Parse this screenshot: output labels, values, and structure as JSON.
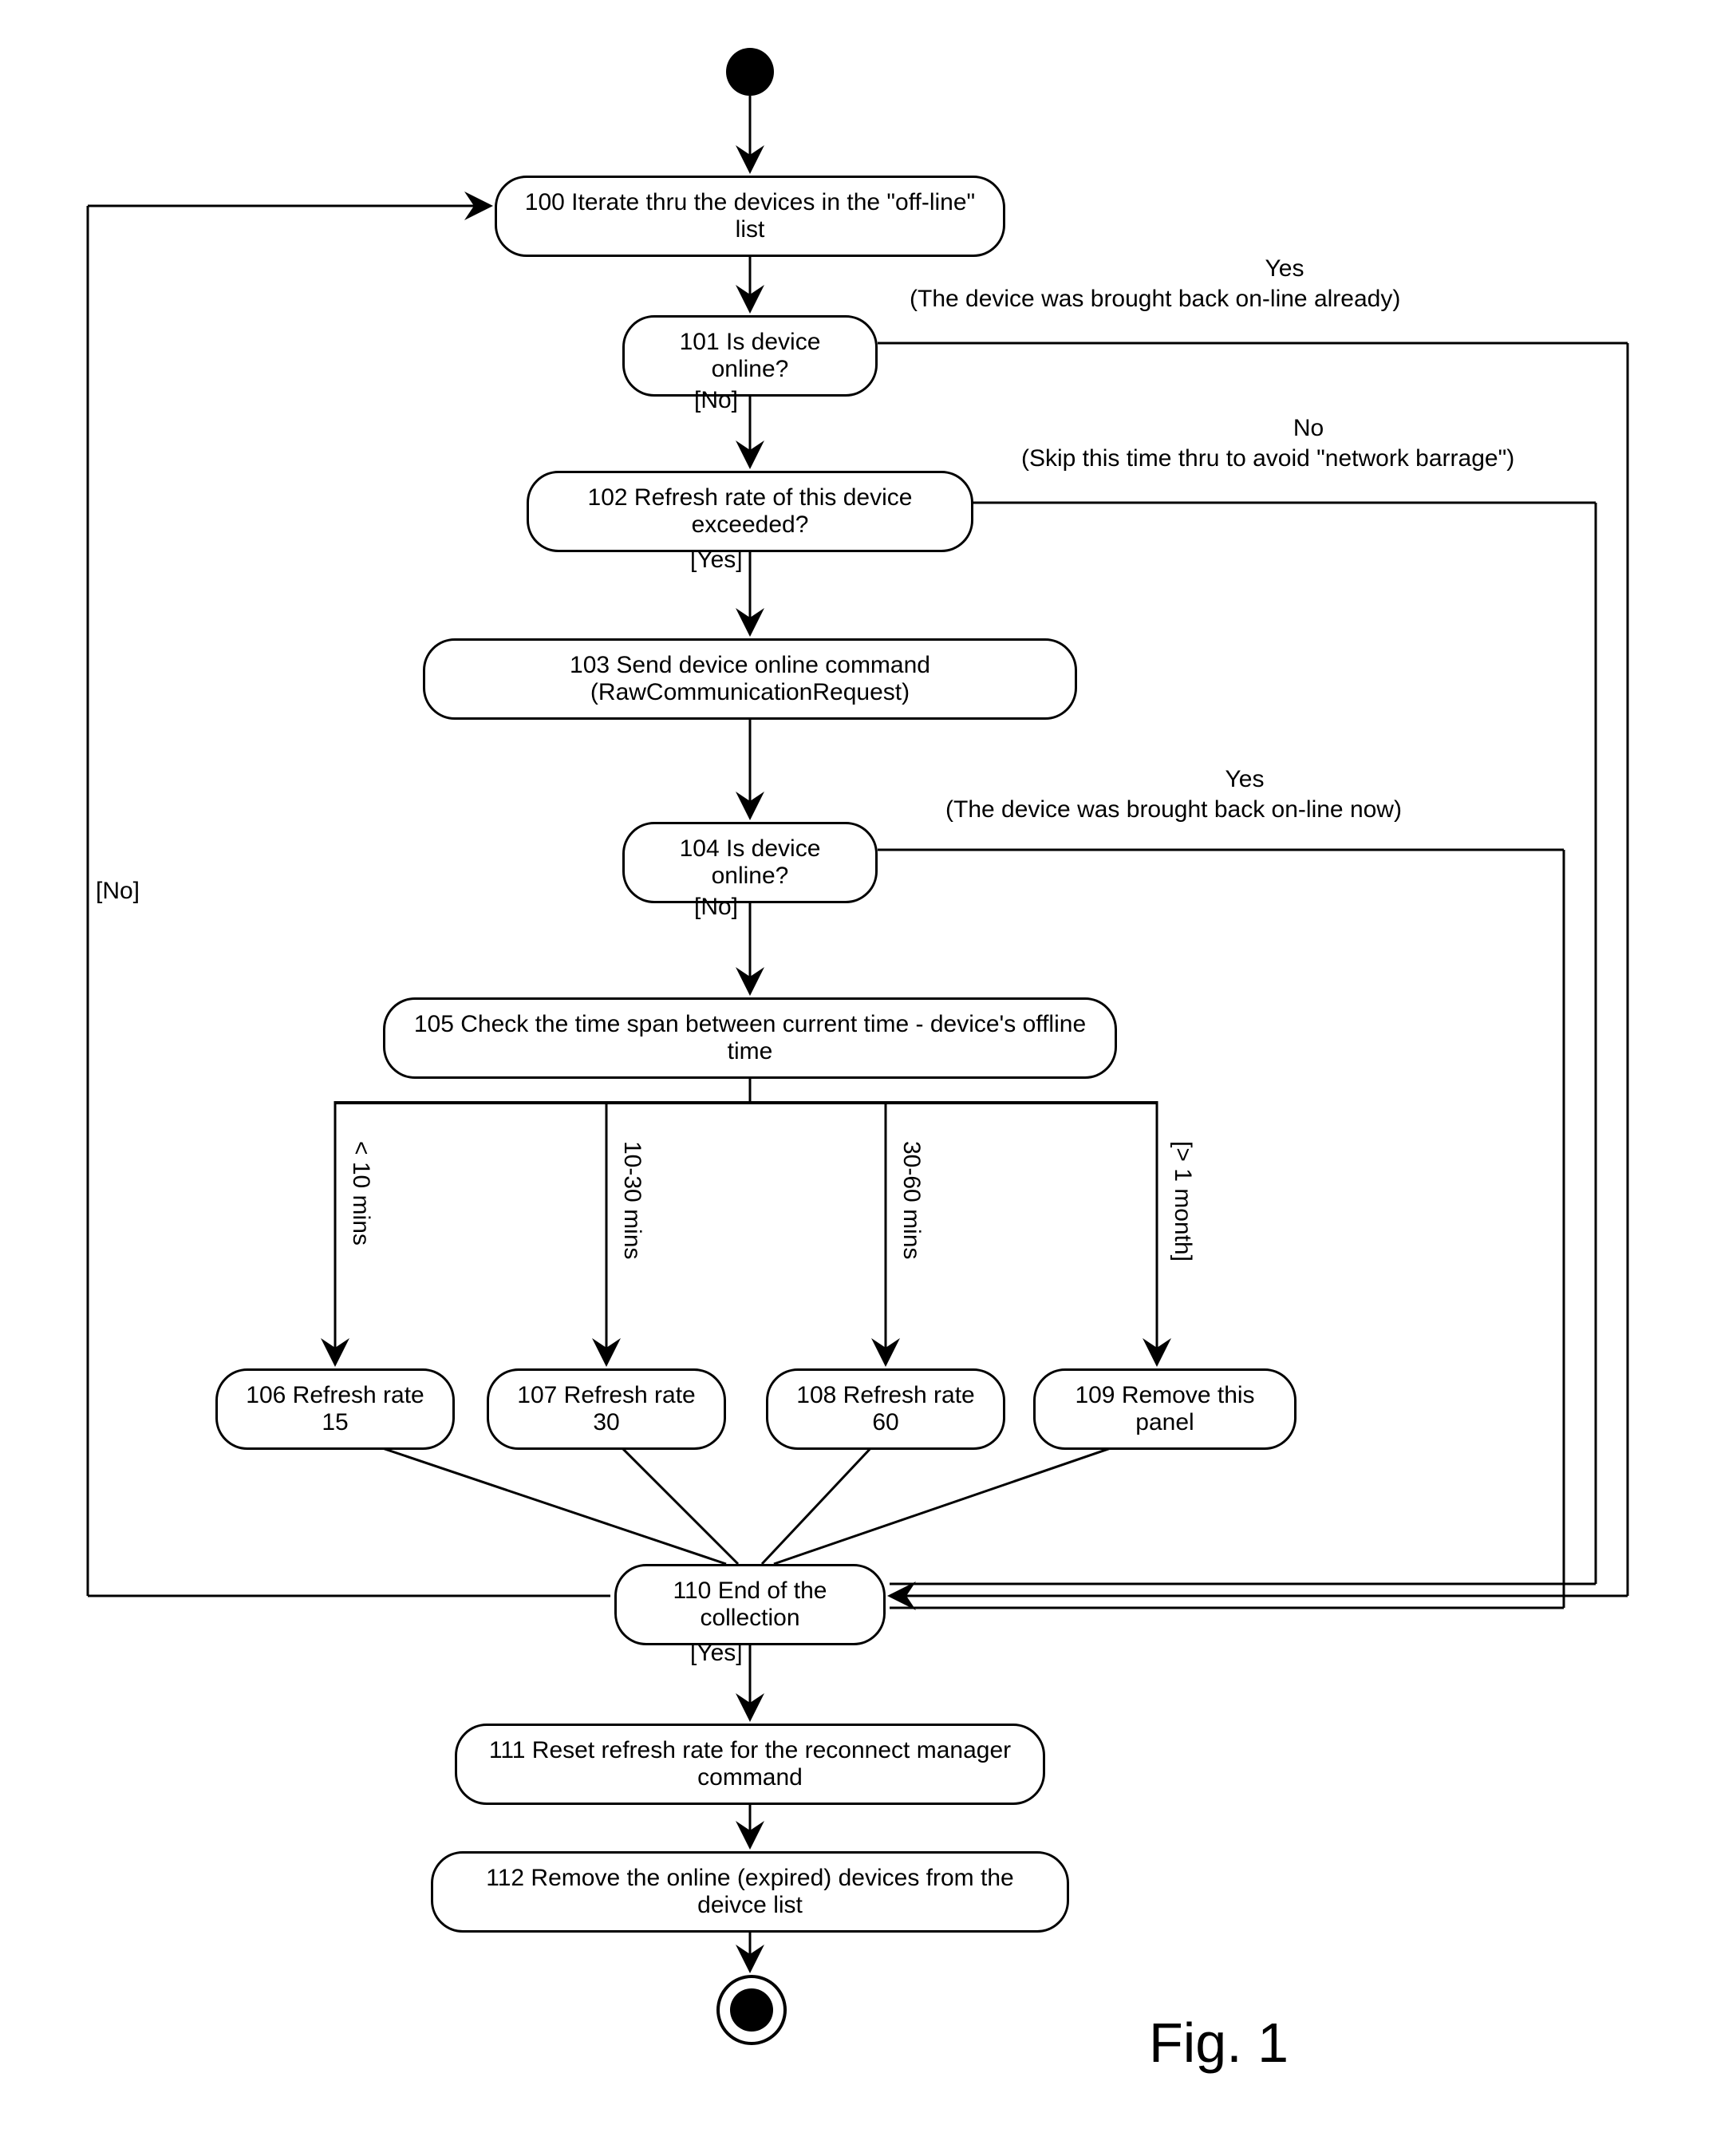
{
  "nodes": {
    "n100": "100 Iterate thru the devices in the \"off-line\" list",
    "n101": "101 Is device online?",
    "n101_no": "[No]",
    "n101_yes": "Yes",
    "n101_yes_sub": "(The device was brought back on-line already)",
    "n102": "102 Refresh rate of this device exceeded?",
    "n102_yes": "[Yes]",
    "n102_no": "No",
    "n102_no_sub": "(Skip this time thru to avoid \"network barrage\")",
    "n103": "103 Send device online command (RawCommunicationRequest)",
    "n104": "104 Is device online?",
    "n104_no": "[No]",
    "n104_yes": "Yes",
    "n104_yes_sub": "(The device was brought back on-line now)",
    "n105": "105 Check  the time span between current time - device's offline time",
    "n106": "106 Refresh rate 15",
    "n107": "107 Refresh rate 30",
    "n108": "108 Refresh rate 60",
    "n109": "109 Remove this panel",
    "b106": "< 10 mins",
    "b107": "10-30 mins",
    "b108": "30-60 mins",
    "b109": "[> 1 month]",
    "n110": "110 End of the collection",
    "n110_yes": "[Yes]",
    "n110_no": "[No]",
    "n111": "111 Reset refresh rate for the reconnect manager command",
    "n112": "112 Remove the online (expired) devices from the deivce list"
  },
  "figure_label": "Fig. 1"
}
